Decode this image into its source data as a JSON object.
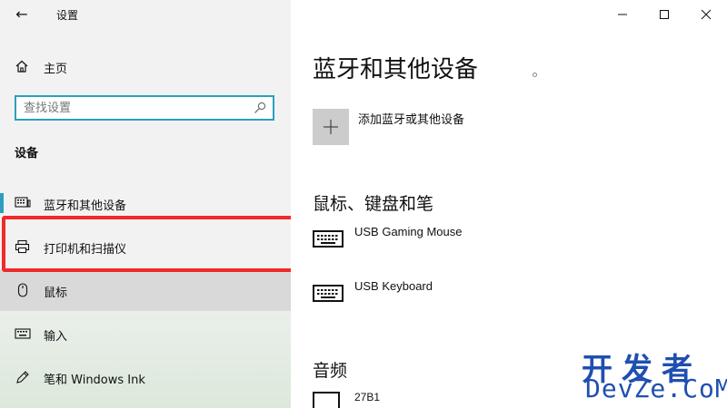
{
  "window": {
    "title": "设置",
    "back_icon": "←",
    "controls": [
      "minimize-icon",
      "maximize-icon",
      "close-icon"
    ]
  },
  "sidebar": {
    "home_label": "主页",
    "search": {
      "placeholder": "查找设置",
      "value": ""
    },
    "section_title": "设备",
    "items": [
      {
        "label": "蓝牙和其他设备",
        "icon": "bluetooth-keyboard-icon",
        "active": true
      },
      {
        "label": "打印机和扫描仪",
        "icon": "printer-icon",
        "active": false
      },
      {
        "label": "鼠标",
        "icon": "mouse-icon",
        "active": false
      },
      {
        "label": "输入",
        "icon": "keyboard-icon",
        "active": false
      },
      {
        "label": "笔和 Windows Ink",
        "icon": "pen-icon",
        "active": false
      }
    ]
  },
  "main": {
    "title": "蓝牙和其他设备",
    "add_device_label": "添加蓝牙或其他设备",
    "groups": [
      {
        "title": "鼠标、键盘和笔",
        "devices": [
          "USB Gaming Mouse",
          "USB Keyboard"
        ]
      },
      {
        "title": "音频",
        "devices": [
          "27B1"
        ]
      }
    ]
  },
  "watermark": {
    "line1": "开发者",
    "line2": "DevZe.CoM"
  },
  "colors": {
    "accent": "#2b9fbe",
    "highlight": "#f02a2a",
    "watermark": "#1f4fb0"
  }
}
